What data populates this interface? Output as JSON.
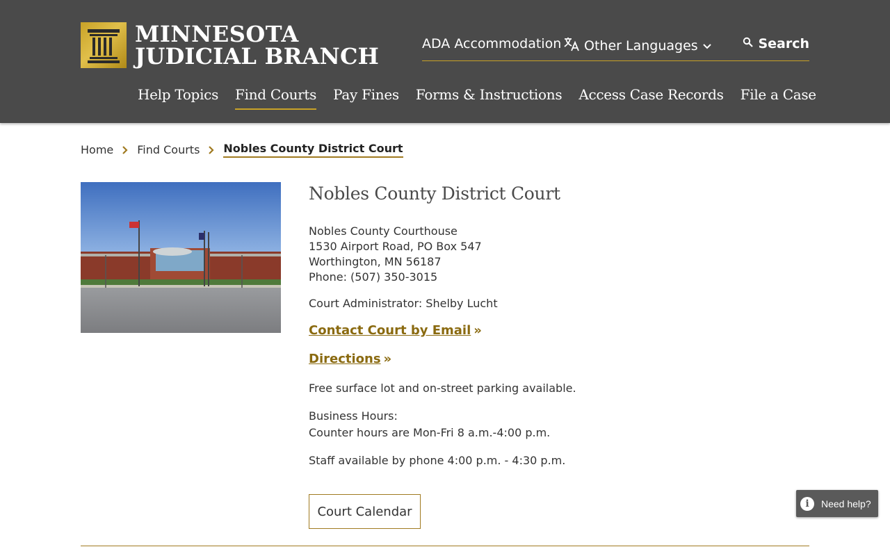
{
  "header": {
    "logo_line1": "MINNESOTA",
    "logo_line2": "JUDICIAL BRANCH",
    "utility": {
      "ada": "ADA Accommodation",
      "languages": "Other Languages",
      "search": "Search"
    },
    "nav": [
      {
        "label": "Help Topics"
      },
      {
        "label": "Find Courts"
      },
      {
        "label": "Pay Fines"
      },
      {
        "label": "Forms & Instructions"
      },
      {
        "label": "Access Case Records"
      },
      {
        "label": "File a Case"
      }
    ],
    "active_nav": "Find Courts"
  },
  "breadcrumb": {
    "home": "Home",
    "find_courts": "Find Courts",
    "current": "Nobles County District Court"
  },
  "court": {
    "title": "Nobles County District Court",
    "address_line1": "Nobles County Courthouse",
    "address_line2": "1530 Airport Road, PO Box 547",
    "address_line3": "Worthington, MN 56187",
    "phone": "Phone: (507) 350-3015",
    "administrator": "Court Administrator: Shelby Lucht",
    "email_link": "Contact Court by Email",
    "directions_link": "Directions",
    "link_suffix": "»",
    "parking": "Free surface lot and on-street parking available.",
    "hours_label": "Business Hours:",
    "hours": "Counter hours are Mon-Fri 8 a.m.-4:00 p.m.",
    "staff": "Staff available by phone 4:00 p.m. - 4:30 p.m.",
    "calendar_button": "Court Calendar"
  },
  "help_widget": {
    "label": "Need help?"
  },
  "colors": {
    "header_bg": "#4a4a4a",
    "accent_gold": "#c9a227",
    "link_gold": "#8a6a10"
  }
}
